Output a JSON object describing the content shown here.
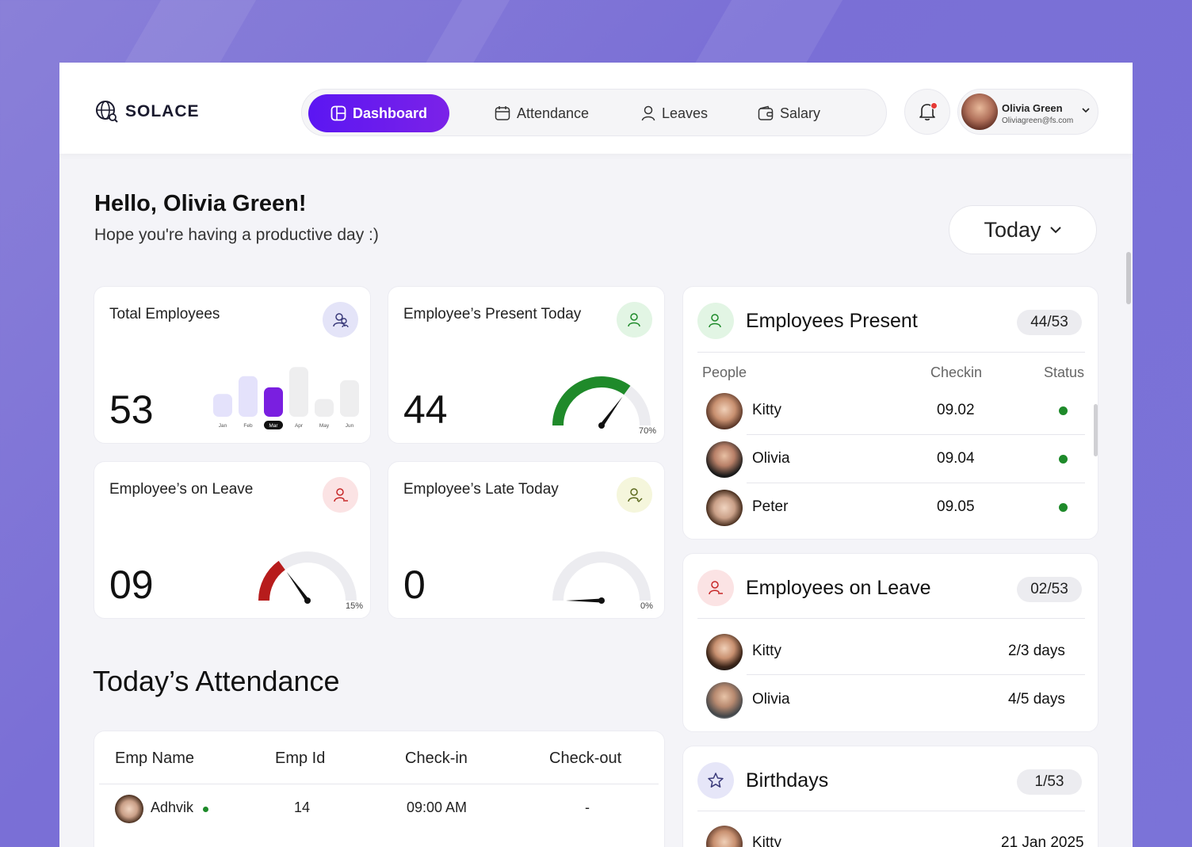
{
  "app": {
    "name": "SOLACE"
  },
  "nav": {
    "items": [
      {
        "label": "Dashboard",
        "icon": "dashboard-icon",
        "active": true
      },
      {
        "label": "Attendance",
        "icon": "calendar-icon"
      },
      {
        "label": "Leaves",
        "icon": "user-icon"
      },
      {
        "label": "Salary",
        "icon": "wallet-icon"
      }
    ]
  },
  "notifications": {
    "unread": true
  },
  "profile": {
    "name": "Olivia Green",
    "email": "Oliviagreen@fs.com"
  },
  "greeting": {
    "title": "Hello, Olivia Green!",
    "subtitle": "Hope you're having a productive day :)"
  },
  "period_selector": {
    "value": "Today"
  },
  "stats": {
    "total": {
      "title": "Total Employees",
      "value": "53",
      "chart": {
        "months": [
          "Jan",
          "Feb",
          "Mar",
          "Apr",
          "May",
          "Jun"
        ],
        "selected": "Mar",
        "levels": [
          0.45,
          0.8,
          0.58,
          0.98,
          0.35,
          0.72
        ]
      }
    },
    "present": {
      "title": "Employee’s Present Today",
      "value": "44",
      "percent": "70%",
      "ratio": 0.7,
      "color": "#1f8a2a"
    },
    "leave": {
      "title": "Employee’s on Leave",
      "value": "09",
      "percent": "15%",
      "ratio": 0.3,
      "color": "#b71c1c"
    },
    "late": {
      "title": "Employee’s Late Today",
      "value": "0",
      "percent": "0%",
      "ratio": 0.0,
      "color": "#c0c0c0"
    }
  },
  "present_panel": {
    "title": "Employees Present",
    "count": "44/53",
    "columns": [
      "People",
      "Checkin",
      "Status"
    ],
    "rows": [
      {
        "name": "Kitty",
        "checkin": "09.02"
      },
      {
        "name": "Olivia",
        "checkin": "09.04"
      },
      {
        "name": "Peter",
        "checkin": "09.05"
      }
    ]
  },
  "leave_panel": {
    "title": "Employees on Leave",
    "count": "02/53",
    "rows": [
      {
        "name": "Kitty",
        "days": "2/3 days"
      },
      {
        "name": "Olivia",
        "days": "4/5 days"
      }
    ]
  },
  "birthday_panel": {
    "title": "Birthdays",
    "count": "1/53",
    "rows": [
      {
        "name": "Kitty",
        "date": "21 Jan 2025"
      }
    ]
  },
  "attendance": {
    "title": "Today’s Attendance",
    "columns": [
      "Emp Name",
      "Emp Id",
      "Check-in",
      "Check-out"
    ],
    "rows": [
      {
        "name": "Adhvik",
        "id": "14",
        "checkin": "09:00 AM",
        "checkout": "-"
      }
    ]
  },
  "colors": {
    "accent": "#5b16f2",
    "present_green": "#1e8a2a",
    "leave_red": "#b71c1c"
  }
}
